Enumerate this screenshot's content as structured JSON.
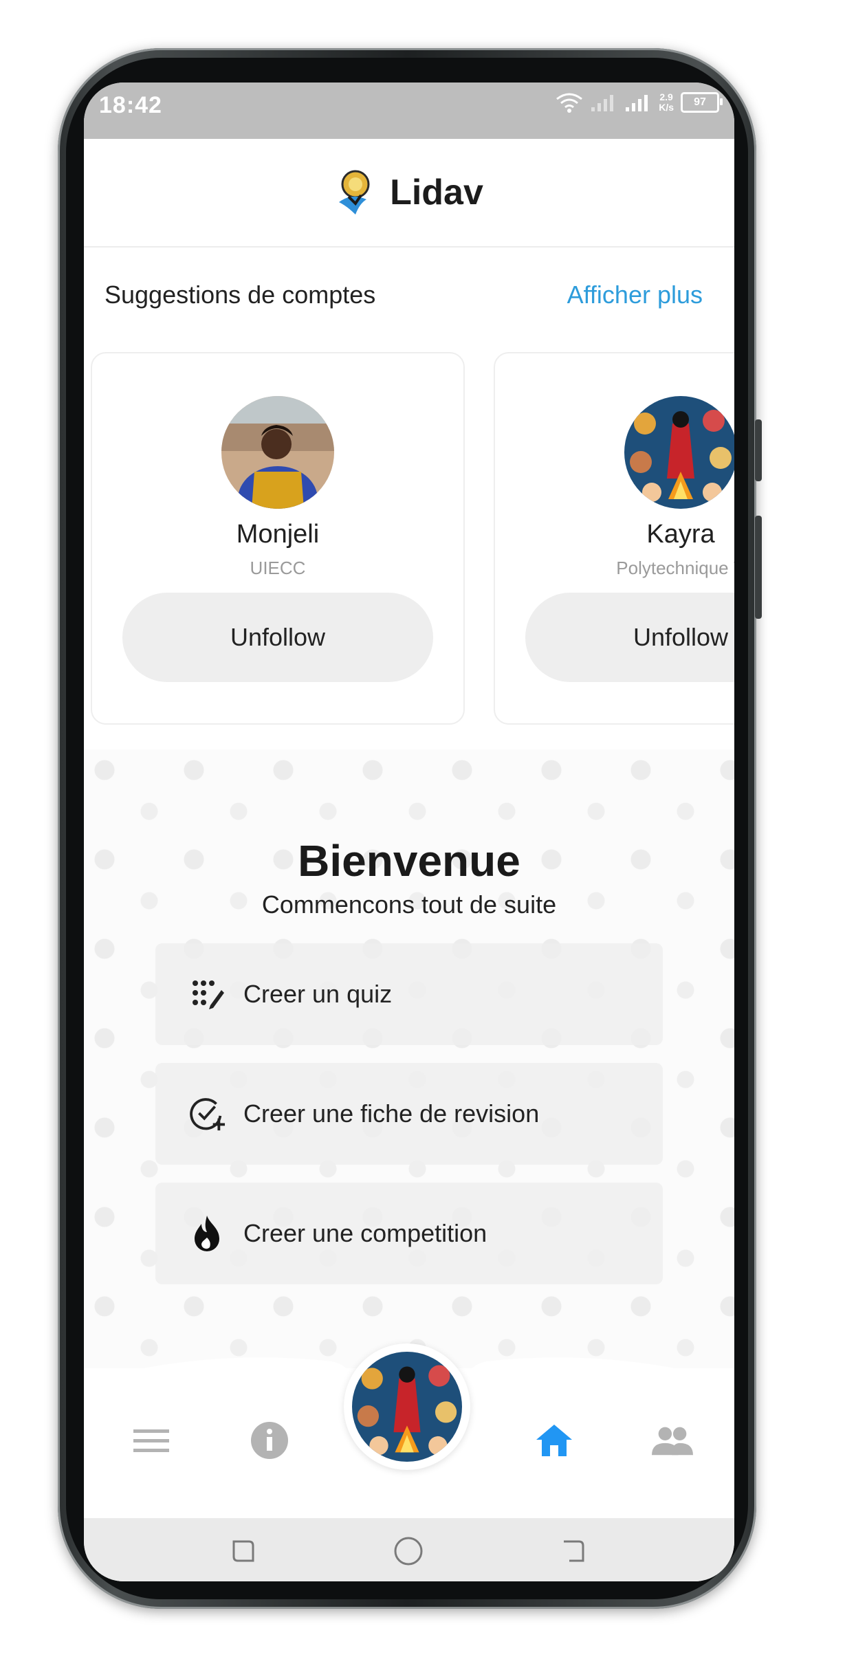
{
  "status": {
    "time": "18:42",
    "net_speed_value": "2.9",
    "net_speed_unit": "K/s",
    "battery": "97"
  },
  "app": {
    "title": "Lidav",
    "logo_icon": "lidav-logo-icon"
  },
  "suggestions": {
    "title": "Suggestions de comptes",
    "show_more": "Afficher plus",
    "cards": [
      {
        "name": "Monjeli",
        "subtitle": "UIECC",
        "button": "Unfollow",
        "avatar": "woman-photo-avatar"
      },
      {
        "name": "Kayra",
        "subtitle": "Polytechnique Y",
        "button": "Unfollow",
        "avatar": "illustration-avatar"
      }
    ]
  },
  "welcome": {
    "title": "Bienvenue",
    "subtitle": "Commencons tout de suite",
    "actions": [
      {
        "label": "Creer un quiz",
        "icon": "quiz-dots-icon"
      },
      {
        "label": "Creer une fiche de revision",
        "icon": "check-plus-icon"
      },
      {
        "label": "Creer une competition",
        "icon": "flame-icon"
      }
    ]
  },
  "bottom_nav": {
    "items": [
      "menu-icon",
      "info-icon",
      "profile-avatar",
      "home-icon",
      "people-icon"
    ],
    "active": "home-icon",
    "colors": {
      "active": "#2196f3",
      "inactive": "#b3b3b3"
    }
  },
  "colors": {
    "accent": "#2d9cdb",
    "button_bg": "#eeeeee",
    "statusbar": "#bdbdbd"
  }
}
